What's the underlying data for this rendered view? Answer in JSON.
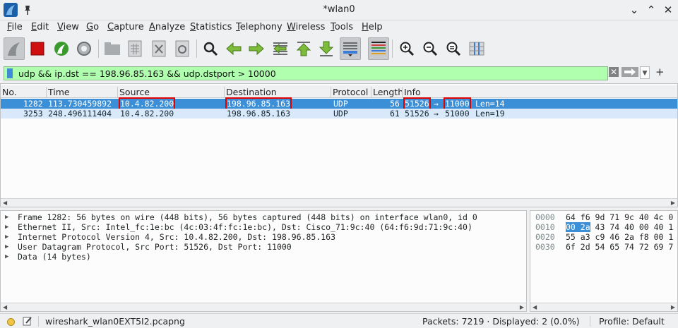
{
  "window": {
    "title": "*wlan0"
  },
  "menu": [
    "File",
    "Edit",
    "View",
    "Go",
    "Capture",
    "Analyze",
    "Statistics",
    "Telephony",
    "Wireless",
    "Tools",
    "Help"
  ],
  "filter": {
    "text": "udp && ip.dst == 198.96.85.163 && udp.dstport > 10000",
    "bg_color": "#afffaf"
  },
  "columns": [
    "No.",
    "Time",
    "Source",
    "Destination",
    "Protocol",
    "Length",
    "Info"
  ],
  "packets": [
    {
      "no": "1282",
      "time": "113.730459892",
      "source": "10.4.82.200",
      "destination": "198.96.85.163",
      "protocol": "UDP",
      "length": "56",
      "src_port": "51526",
      "arrow": "→",
      "dst_port": "11000",
      "len": "Len=14",
      "selected": true
    },
    {
      "no": "3253",
      "time": "248.496111404",
      "source": "10.4.82.200",
      "destination": "198.96.85.163",
      "protocol": "UDP",
      "length": "61",
      "src_port": "51526",
      "arrow": "→",
      "dst_port": "51000",
      "len": "Len=19",
      "selected": false
    }
  ],
  "details": [
    "Frame 1282: 56 bytes on wire (448 bits), 56 bytes captured (448 bits) on interface wlan0, id 0",
    "Ethernet II, Src: Intel_fc:1e:bc (4c:03:4f:fc:1e:bc), Dst: Cisco_71:9c:40 (64:f6:9d:71:9c:40)",
    "Internet Protocol Version 4, Src: 10.4.82.200, Dst: 198.96.85.163",
    "User Datagram Protocol, Src Port: 51526, Dst Port: 11000",
    "Data (14 bytes)"
  ],
  "bytes": {
    "offsets": [
      "0000",
      "0010",
      "0020",
      "0030"
    ],
    "rows": [
      {
        "sel": "",
        "rest": "64 f6 9d 71 9c 40 4c 0"
      },
      {
        "sel": "00 2a",
        "rest": " 43 74 40 00 40 1"
      },
      {
        "sel": "",
        "rest": "55 a3 c9 46 2a f8 00 1"
      },
      {
        "sel": "",
        "rest": "6f 2d 54 65 74 72 69 7"
      }
    ]
  },
  "status": {
    "file": "wireshark_wlan0EXT5I2.pcapng",
    "packets": "Packets: 7219 · Displayed: 2 (0.0%)",
    "profile": "Profile: Default"
  },
  "colors": {
    "selected_row": "#3b8fd6",
    "second_row": "#dae8fc",
    "highlight_box": "#e00000"
  }
}
